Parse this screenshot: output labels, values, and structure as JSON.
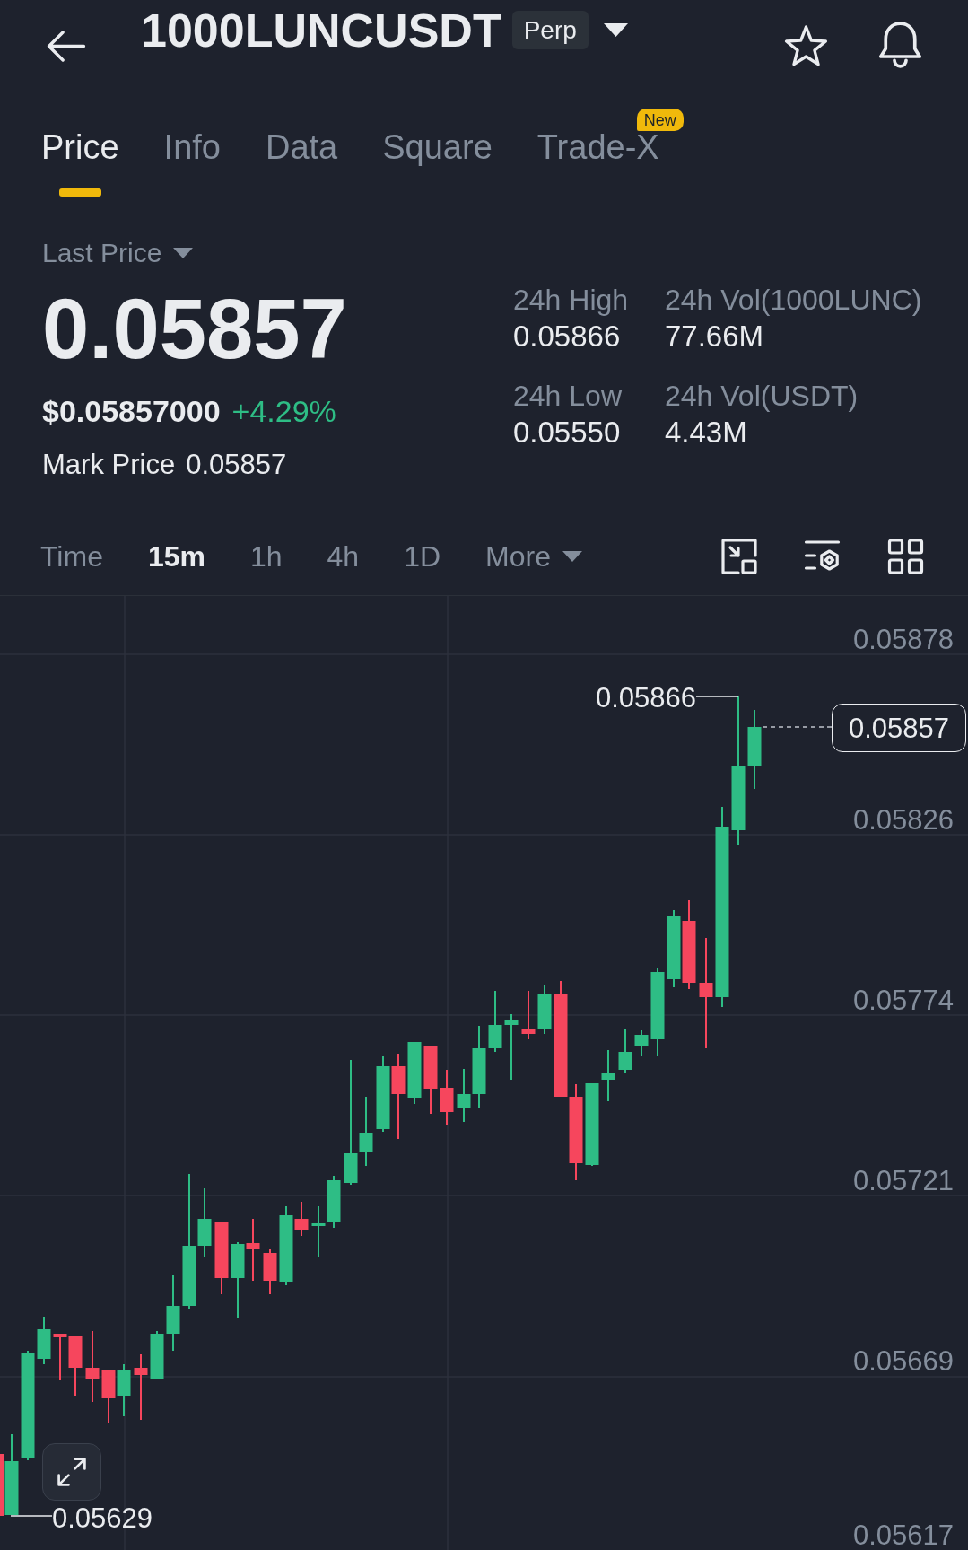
{
  "header": {
    "title": "1000LUNCUSDT",
    "badge": "Perp"
  },
  "tabs": [
    {
      "label": "Price",
      "selected": true
    },
    {
      "label": "Info",
      "selected": false
    },
    {
      "label": "Data",
      "selected": false
    },
    {
      "label": "Square",
      "selected": false
    },
    {
      "label": "Trade-X",
      "selected": false,
      "badge": "New"
    }
  ],
  "price_panel": {
    "price_type": "Last Price",
    "last_price": "0.05857",
    "usd_price": "$0.05857000",
    "change": "+4.29%",
    "rising": true,
    "mark_price_label": "Mark Price",
    "mark_price": "0.05857"
  },
  "stats": [
    {
      "label": "24h High",
      "value": "0.05866"
    },
    {
      "label": "24h Vol(1000LUNC)",
      "value": "77.66M"
    },
    {
      "label": "24h Low",
      "value": "0.05550"
    },
    {
      "label": "24h Vol(USDT)",
      "value": "4.43M"
    }
  ],
  "intervals": [
    {
      "label": "Time",
      "kind": "option",
      "selected": false
    },
    {
      "label": "15m",
      "kind": "option",
      "selected": true
    },
    {
      "label": "1h",
      "kind": "option",
      "selected": false
    },
    {
      "label": "4h",
      "kind": "option",
      "selected": false
    },
    {
      "label": "1D",
      "kind": "option",
      "selected": false
    },
    {
      "label": "More",
      "kind": "dropdown",
      "selected": false
    }
  ],
  "chart": {
    "price_axis": [
      "0.05878",
      "0.05826",
      "0.05774",
      "0.05721",
      "0.05669",
      "0.05617"
    ],
    "high_label": "0.05866",
    "current_price": "0.05857",
    "low_label": "0.05629"
  }
}
